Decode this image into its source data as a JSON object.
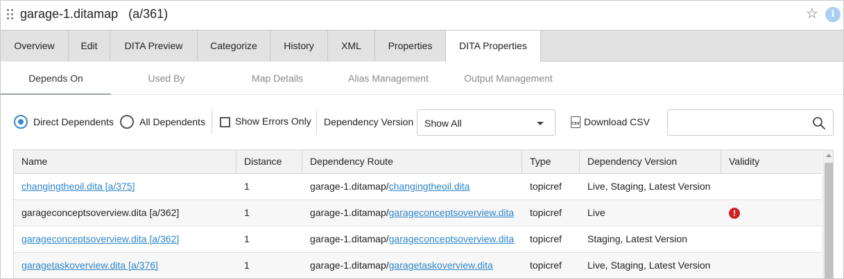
{
  "window": {
    "title": "garage-1.ditamap",
    "id": "(a/361)",
    "favorite_icon": "star-outline-icon",
    "info_icon": "info-icon",
    "info_glyph": "i"
  },
  "tabs": [
    {
      "label": "Overview"
    },
    {
      "label": "Edit"
    },
    {
      "label": "DITA Preview"
    },
    {
      "label": "Categorize"
    },
    {
      "label": "History"
    },
    {
      "label": "XML"
    },
    {
      "label": "Properties"
    },
    {
      "label": "DITA Properties",
      "active": true
    }
  ],
  "subtabs": [
    {
      "label": "Depends On",
      "active": true
    },
    {
      "label": "Used By"
    },
    {
      "label": "Map Details"
    },
    {
      "label": "Alias Management"
    },
    {
      "label": "Output Management"
    }
  ],
  "toolbar": {
    "direct_dependents": "Direct Dependents",
    "all_dependents": "All Dependents",
    "selected_scope": "Direct Dependents",
    "show_errors_only": "Show Errors Only",
    "show_errors_checked": false,
    "dependency_version_label": "Dependency Version",
    "dependency_version_value": "Show All",
    "download_csv": "Download CSV",
    "csv_icon_text": "CSV",
    "search_value": ""
  },
  "table": {
    "columns": [
      "Name",
      "Distance",
      "Dependency Route",
      "Type",
      "Dependency Version",
      "Validity"
    ],
    "rows": [
      {
        "name": "changingtheoil.dita [a/375]",
        "name_link": true,
        "distance": "1",
        "route_prefix": "garage-1.ditamap/",
        "route_link": "changingtheoil.dita",
        "type": "topicref",
        "version": "Live, Staging, Latest Version",
        "validity": ""
      },
      {
        "name": "garageconceptsoverview.dita [a/362]",
        "name_link": false,
        "distance": "1",
        "route_prefix": "garage-1.ditamap/",
        "route_link": "garageconceptsoverview.dita",
        "type": "topicref",
        "version": "Live",
        "validity": "!"
      },
      {
        "name": "garageconceptsoverview.dita [a/362]",
        "name_link": true,
        "distance": "1",
        "route_prefix": "garage-1.ditamap/",
        "route_link": "garageconceptsoverview.dita",
        "type": "topicref",
        "version": "Staging, Latest Version",
        "validity": ""
      },
      {
        "name": "garagetaskoverview.dita [a/376]",
        "name_link": true,
        "distance": "1",
        "route_prefix": "garage-1.ditamap/",
        "route_link": "garagetaskoverview.dita",
        "type": "topicref",
        "version": "Live, Staging, Latest Version",
        "validity": ""
      }
    ]
  },
  "colors": {
    "accent": "#3a86c8",
    "link": "#2e86c9",
    "error": "#cc2027",
    "tab_bg": "#e2e2e2"
  }
}
